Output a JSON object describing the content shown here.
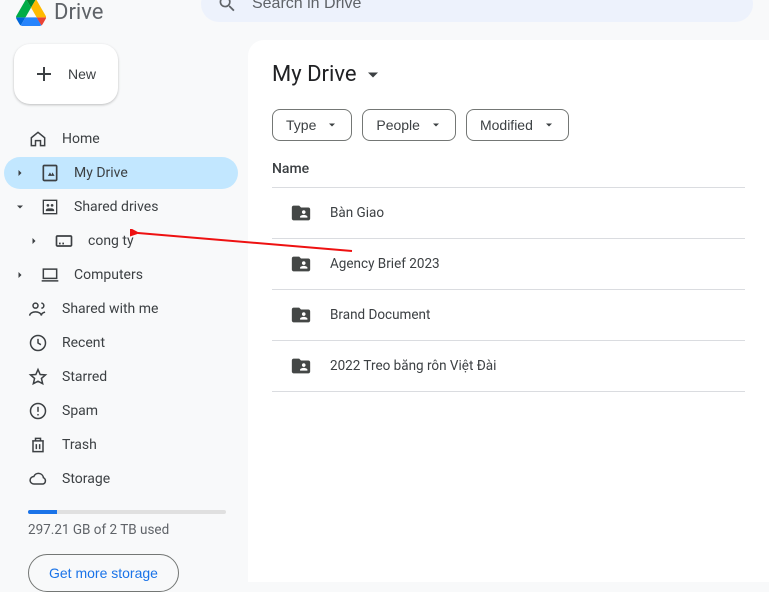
{
  "brand": "Drive",
  "search": {
    "placeholder": "Search in Drive"
  },
  "new_button": "New",
  "nav": {
    "home": "Home",
    "my_drive": "My Drive",
    "shared_drives": "Shared drives",
    "cong_ty": "cong ty",
    "computers": "Computers",
    "shared_with_me": "Shared with me",
    "recent": "Recent",
    "starred": "Starred",
    "spam": "Spam",
    "trash": "Trash",
    "storage": "Storage"
  },
  "storage": {
    "used_text": "297.21 GB of 2 TB used",
    "cta": "Get more storage"
  },
  "breadcrumb": "My Drive",
  "filters": {
    "type": "Type",
    "people": "People",
    "modified": "Modified"
  },
  "columns": {
    "name": "Name"
  },
  "folders": [
    {
      "name": "Bàn Giao"
    },
    {
      "name": "Agency Brief 2023"
    },
    {
      "name": "Brand Document"
    },
    {
      "name": "2022 Treo băng rôn Việt Đài"
    }
  ]
}
